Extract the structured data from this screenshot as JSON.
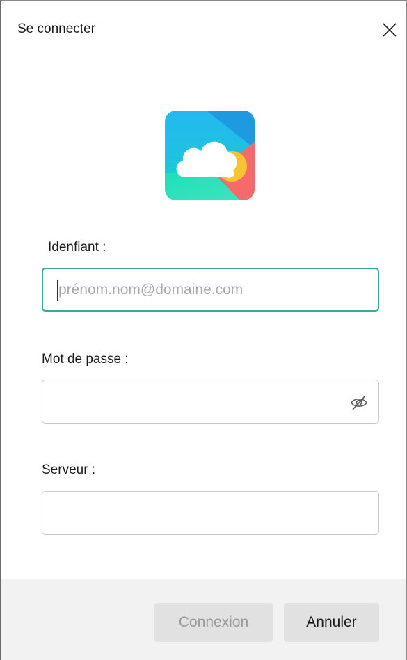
{
  "dialog": {
    "title": "Se connecter"
  },
  "form": {
    "login": {
      "label": "Idenfiant :",
      "placeholder": "prénom.nom@domaine.com",
      "value": ""
    },
    "password": {
      "label": "Mot de passe :",
      "value": ""
    },
    "server": {
      "label": "Serveur :",
      "value": ""
    }
  },
  "footer": {
    "connect_label": "Connexion",
    "cancel_label": "Annuler"
  },
  "icons": {
    "close": "close-icon",
    "eye": "eye-slash-icon",
    "logo": "cloud-sun-logo"
  },
  "colors": {
    "focus_border": "#3aa79b",
    "footer_bg": "#f2f2f2",
    "button_bg": "#e1e1e1",
    "disabled_text": "#9a9a9a"
  }
}
